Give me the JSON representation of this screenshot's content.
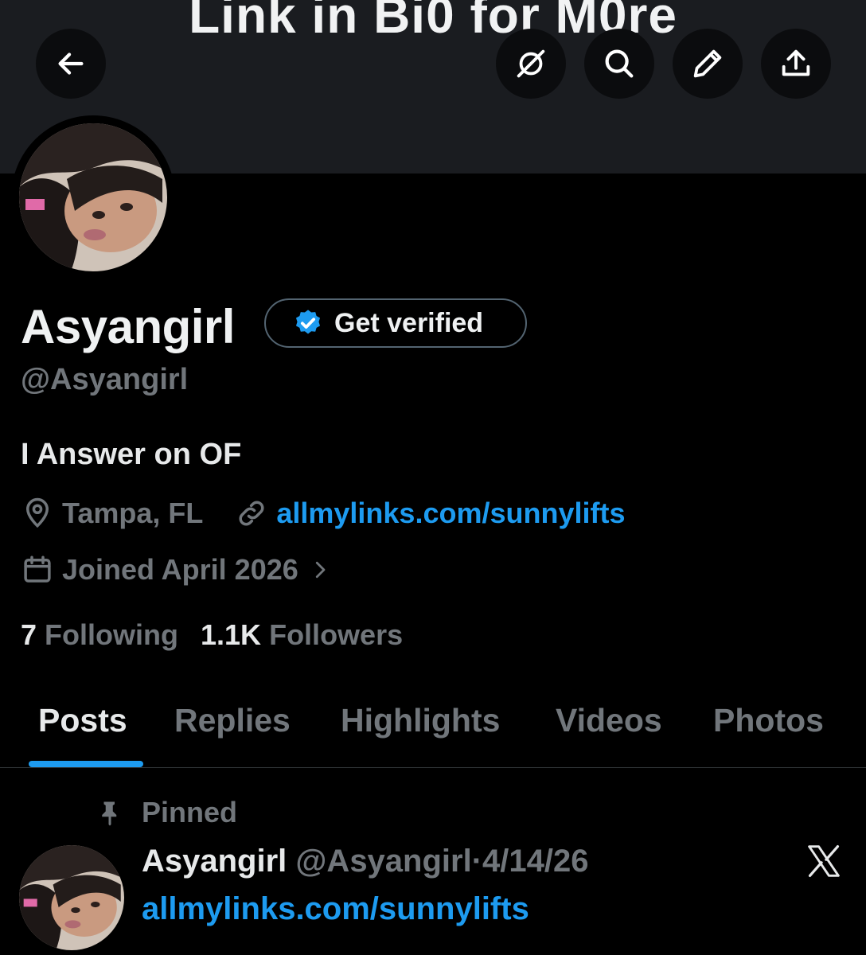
{
  "banner": {
    "text": "Link in Bi0 for M0re"
  },
  "header_buttons": {
    "back": "back-arrow-icon",
    "grok": "grok-icon",
    "search": "search-icon",
    "edit": "pencil-icon",
    "share": "share-icon"
  },
  "profile": {
    "name": "Asyangirl",
    "handle": "@Asyangirl",
    "verify_label": "Get verified",
    "bio": "I Answer on OF",
    "location": "Tampa, FL",
    "website": "allmylinks.com/sunnylifts",
    "joined": "Joined April 2026",
    "following_count": "7",
    "following_label": "Following",
    "followers_count": "1.1K",
    "followers_label": "Followers"
  },
  "tabs": [
    "Posts",
    "Replies",
    "Highlights",
    "Videos",
    "Photos"
  ],
  "active_tab": "Posts",
  "pinned_post": {
    "pinned_label": "Pinned",
    "author_name": "Asyangirl",
    "author_handle": "@Asyangirl",
    "separator": "·",
    "date": "4/14/26",
    "text": "allmylinks.com/sunnylifts"
  },
  "colors": {
    "accent": "#1d9bf0",
    "muted": "#71767b",
    "background": "#000000"
  }
}
